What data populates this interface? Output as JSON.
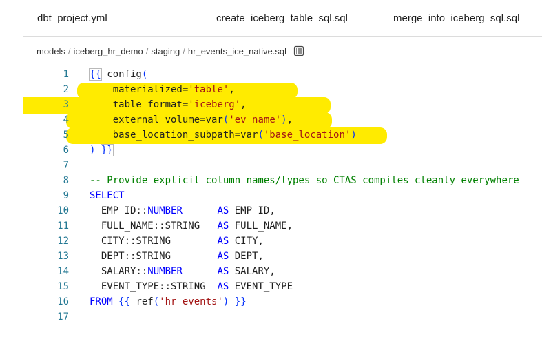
{
  "tabs": [
    {
      "label": "dbt_project.yml"
    },
    {
      "label": "create_iceberg_table_sql.sql"
    },
    {
      "label": "merge_into_iceberg_sql.sql"
    }
  ],
  "breadcrumb": {
    "segments": [
      "models",
      "iceberg_hr_demo",
      "staging",
      "hr_events_ice_native.sql"
    ],
    "separator": "/",
    "outline_icon": "list-outline-icon"
  },
  "highlight_color": "#ffeb00",
  "code": {
    "lines": [
      {
        "n": "1",
        "tokens": [
          {
            "t": "{{",
            "c": "brbox"
          },
          {
            "t": " config",
            "c": "pl"
          },
          {
            "t": "(",
            "c": "br"
          }
        ]
      },
      {
        "n": "2",
        "tokens": [
          {
            "t": "    materialized=",
            "c": "pl"
          },
          {
            "t": "'table'",
            "c": "str"
          },
          {
            "t": ",",
            "c": "pl"
          }
        ]
      },
      {
        "n": "3",
        "tokens": [
          {
            "t": "    table_format=",
            "c": "pl"
          },
          {
            "t": "'iceberg'",
            "c": "str"
          },
          {
            "t": ",",
            "c": "pl"
          }
        ]
      },
      {
        "n": "4",
        "tokens": [
          {
            "t": "    external_volume=var",
            "c": "pl"
          },
          {
            "t": "(",
            "c": "br"
          },
          {
            "t": "'ev_name'",
            "c": "str"
          },
          {
            "t": ")",
            "c": "br"
          },
          {
            "t": ",",
            "c": "pl"
          }
        ]
      },
      {
        "n": "5",
        "tokens": [
          {
            "t": "    base_location_subpath=var",
            "c": "pl"
          },
          {
            "t": "(",
            "c": "br"
          },
          {
            "t": "'base_location'",
            "c": "str"
          },
          {
            "t": ")",
            "c": "br"
          }
        ]
      },
      {
        "n": "6",
        "tokens": [
          {
            "t": ")",
            "c": "br"
          },
          {
            "t": " ",
            "c": "pl"
          },
          {
            "t": "}}",
            "c": "brbox"
          }
        ]
      },
      {
        "n": "7",
        "tokens": []
      },
      {
        "n": "8",
        "tokens": [
          {
            "t": "-- Provide explicit column names/types so CTAS compiles cleanly everywhere",
            "c": "cm"
          }
        ]
      },
      {
        "n": "9",
        "tokens": [
          {
            "t": "SELECT",
            "c": "kw"
          }
        ]
      },
      {
        "n": "10",
        "tokens": [
          {
            "t": "  EMP_ID::",
            "c": "pl"
          },
          {
            "t": "NUMBER",
            "c": "kw"
          },
          {
            "t": "      ",
            "c": "pl"
          },
          {
            "t": "AS",
            "c": "kw"
          },
          {
            "t": " EMP_ID,",
            "c": "pl"
          }
        ]
      },
      {
        "n": "11",
        "tokens": [
          {
            "t": "  FULL_NAME::STRING   ",
            "c": "pl"
          },
          {
            "t": "AS",
            "c": "kw"
          },
          {
            "t": " FULL_NAME,",
            "c": "pl"
          }
        ]
      },
      {
        "n": "12",
        "tokens": [
          {
            "t": "  CITY::STRING        ",
            "c": "pl"
          },
          {
            "t": "AS",
            "c": "kw"
          },
          {
            "t": " CITY,",
            "c": "pl"
          }
        ]
      },
      {
        "n": "13",
        "tokens": [
          {
            "t": "  DEPT::STRING        ",
            "c": "pl"
          },
          {
            "t": "AS",
            "c": "kw"
          },
          {
            "t": " DEPT,",
            "c": "pl"
          }
        ]
      },
      {
        "n": "14",
        "tokens": [
          {
            "t": "  SALARY::",
            "c": "pl"
          },
          {
            "t": "NUMBER",
            "c": "kw"
          },
          {
            "t": "      ",
            "c": "pl"
          },
          {
            "t": "AS",
            "c": "kw"
          },
          {
            "t": " SALARY,",
            "c": "pl"
          }
        ]
      },
      {
        "n": "15",
        "tokens": [
          {
            "t": "  EVENT_TYPE::STRING  ",
            "c": "pl"
          },
          {
            "t": "AS",
            "c": "kw"
          },
          {
            "t": " EVENT_TYPE",
            "c": "pl"
          }
        ]
      },
      {
        "n": "16",
        "tokens": [
          {
            "t": "FROM",
            "c": "kw"
          },
          {
            "t": " ",
            "c": "pl"
          },
          {
            "t": "{{",
            "c": "br"
          },
          {
            "t": " ref",
            "c": "pl"
          },
          {
            "t": "(",
            "c": "br"
          },
          {
            "t": "'hr_events'",
            "c": "str"
          },
          {
            "t": ")",
            "c": "br"
          },
          {
            "t": " ",
            "c": "pl"
          },
          {
            "t": "}}",
            "c": "br"
          }
        ]
      },
      {
        "n": "17",
        "tokens": []
      }
    ]
  }
}
